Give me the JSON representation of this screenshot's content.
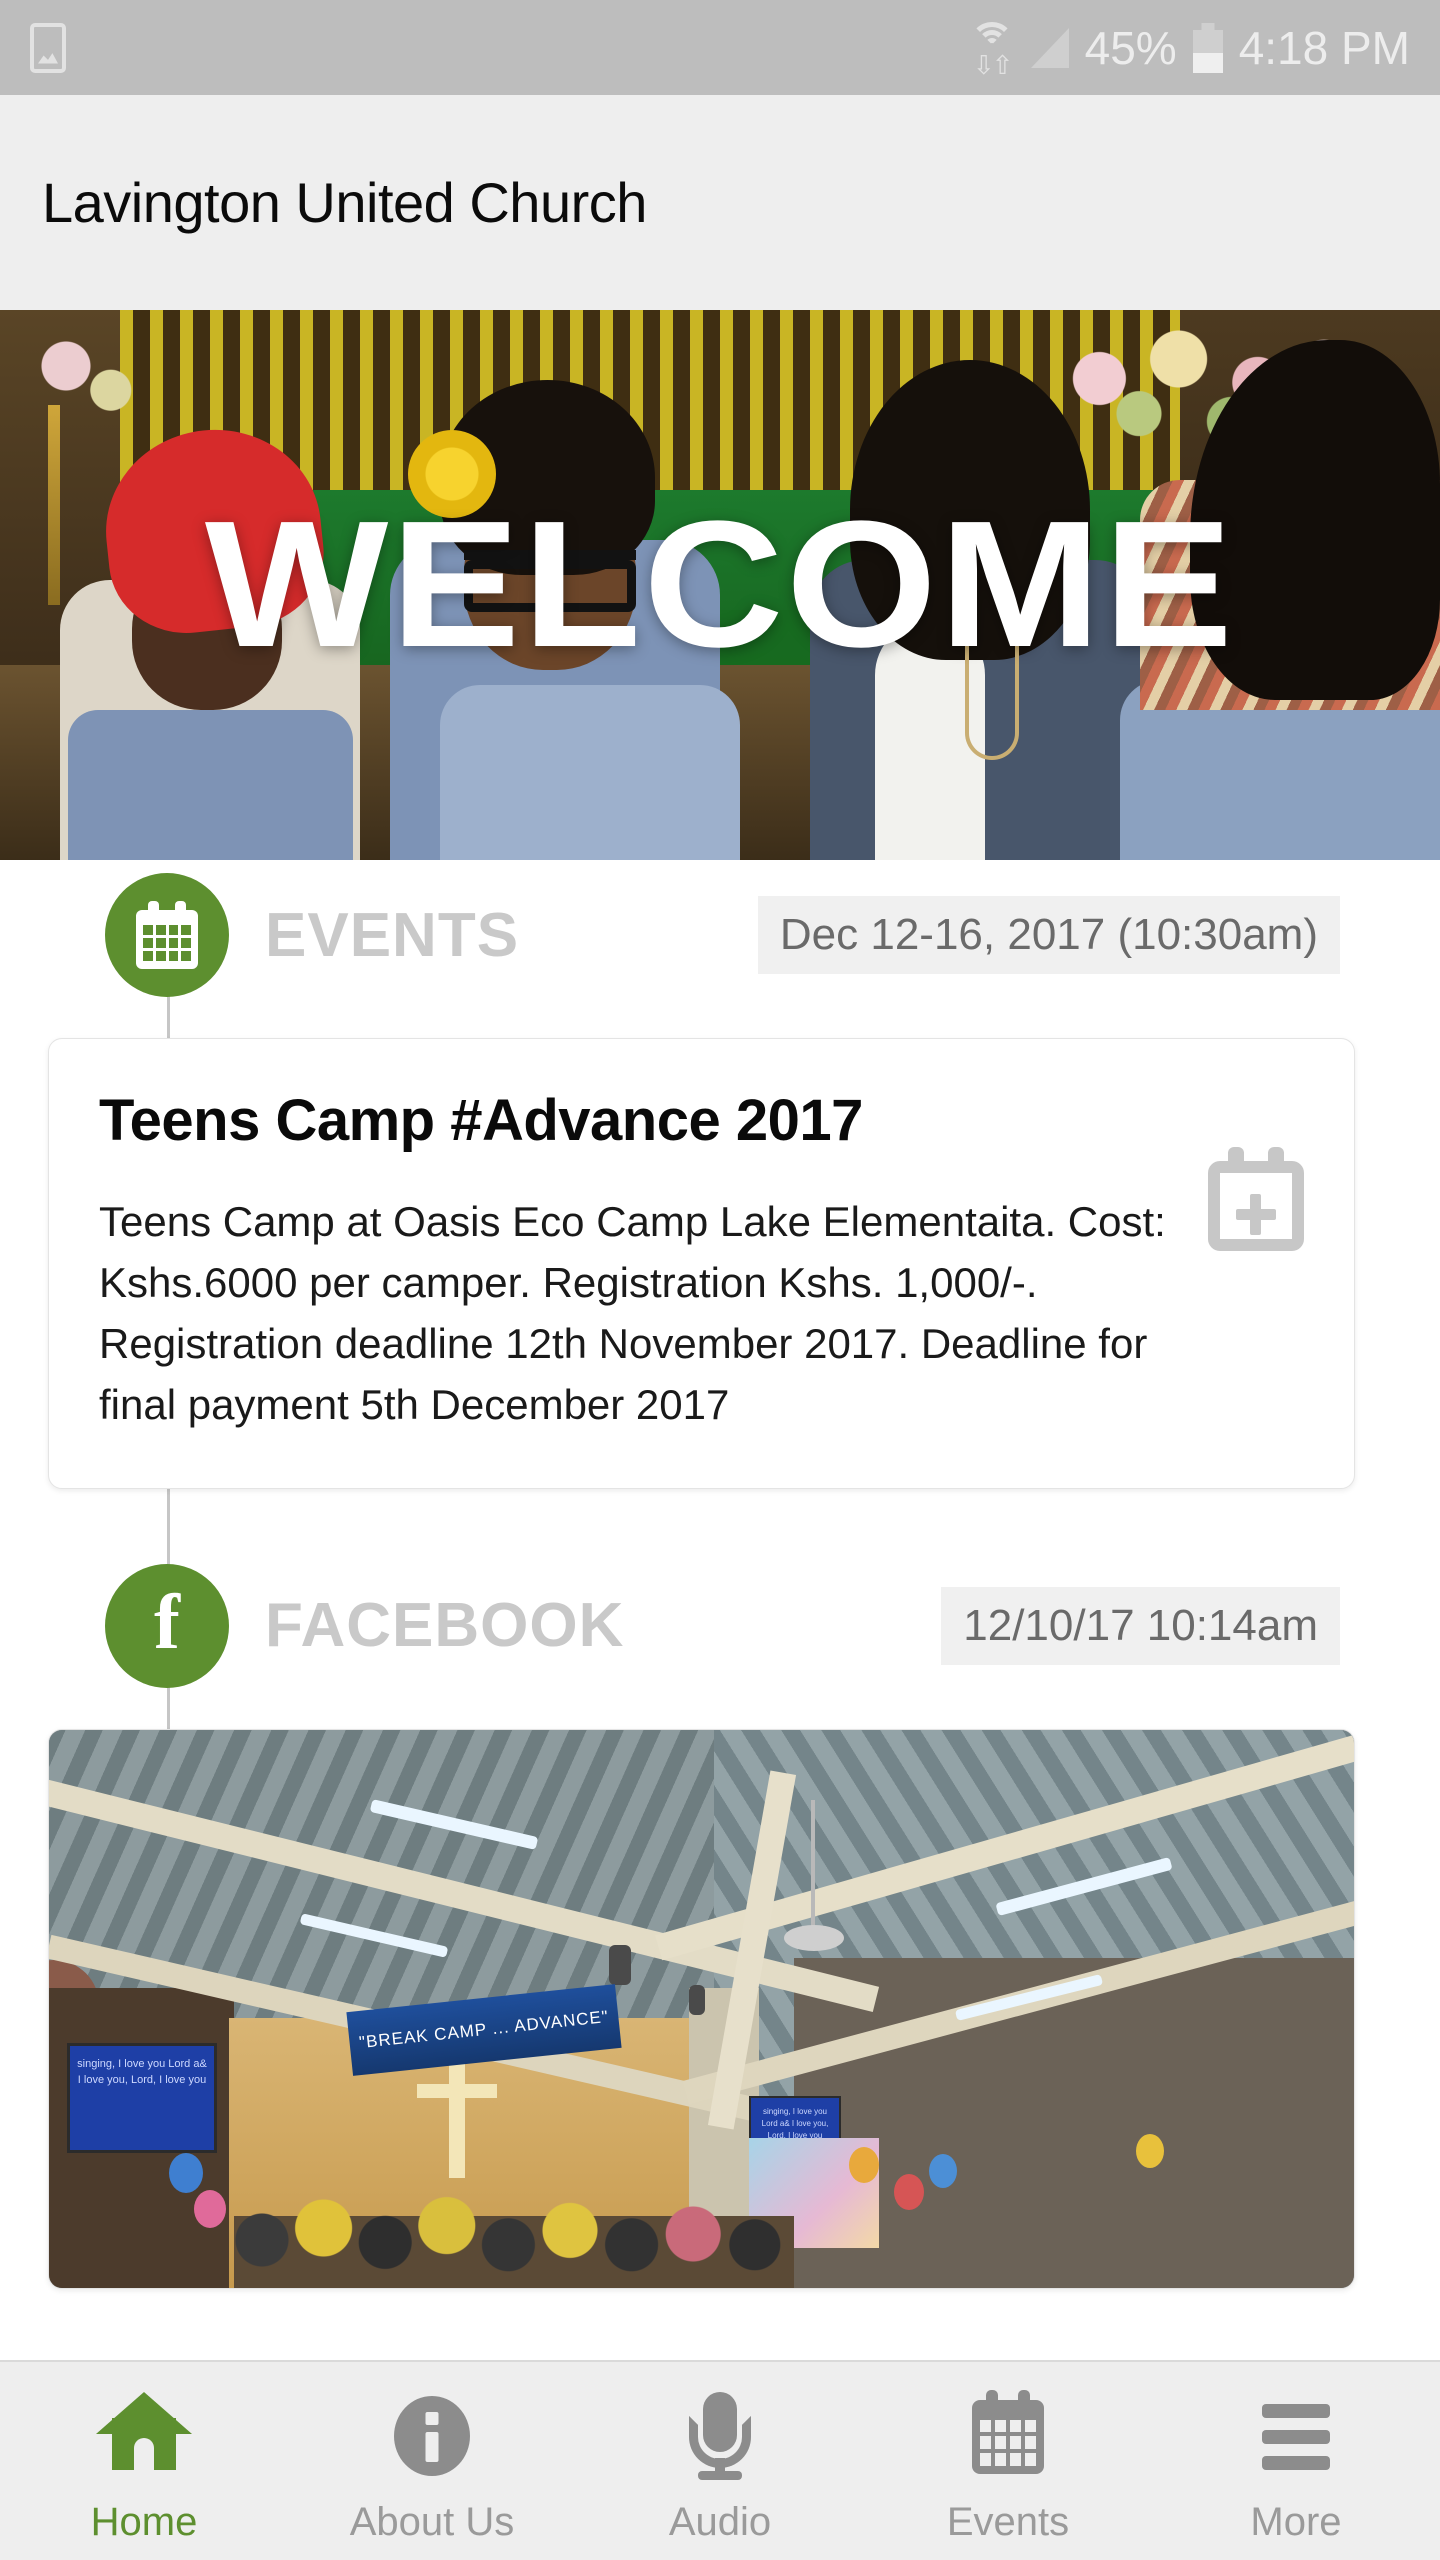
{
  "status_bar": {
    "screenshot_icon": "screenshot-icon",
    "wifi_icon": "wifi-icon",
    "signal_icon": "cellular-signal-icon",
    "battery_percent": "45%",
    "battery_icon": "battery-icon",
    "time": "4:18 PM"
  },
  "header": {
    "title": "Lavington United Church"
  },
  "hero": {
    "overlay_text": "WELCOME",
    "alt": "Four women seated together in a church sanctuary with a yellow and green striped backdrop and flower arrangements"
  },
  "feed": {
    "sections": [
      {
        "id": "events",
        "icon": "calendar-icon",
        "title": "EVENTS",
        "date": "Dec 12-16, 2017 (10:30am)",
        "card": {
          "title": "Teens Camp #Advance 2017",
          "text": "Teens Camp at Oasis Eco Camp Lake Elementaita. Cost: Kshs.6000 per camper. Registration Kshs. 1,000/-. Registration deadline 12th November 2017. Deadline for final payment 5th December 2017",
          "action_icon": "add-to-calendar-icon"
        }
      },
      {
        "id": "facebook",
        "icon": "facebook-icon",
        "icon_glyph": "f",
        "title": "FACEBOOK",
        "date": "12/10/17 10:14am",
        "photo": {
          "alt": "Church interior with vaulted metal ceiling, wooden cross, projection screens and a congregation with balloons",
          "banner_text": "\"BREAK CAMP ... ADVANCE\"",
          "screen_text": "singing, I love you Lord a& I love you, Lord, I love you"
        }
      }
    ]
  },
  "bottom_nav": {
    "items": [
      {
        "label": "Home",
        "icon": "home-icon",
        "active": true
      },
      {
        "label": "About Us",
        "icon": "info-icon",
        "active": false
      },
      {
        "label": "Audio",
        "icon": "microphone-icon",
        "active": false
      },
      {
        "label": "Events",
        "icon": "calendar-icon",
        "active": false
      },
      {
        "label": "More",
        "icon": "hamburger-menu-icon",
        "active": false
      }
    ]
  },
  "colors": {
    "accent_green": "#5d8f2f",
    "header_bg": "#eeeeee",
    "status_bar_bg": "#bdbdbd",
    "muted_text": "#c9c9c9",
    "badge_bg": "#f0f0f0",
    "inactive_icon": "#8c8c8c"
  }
}
